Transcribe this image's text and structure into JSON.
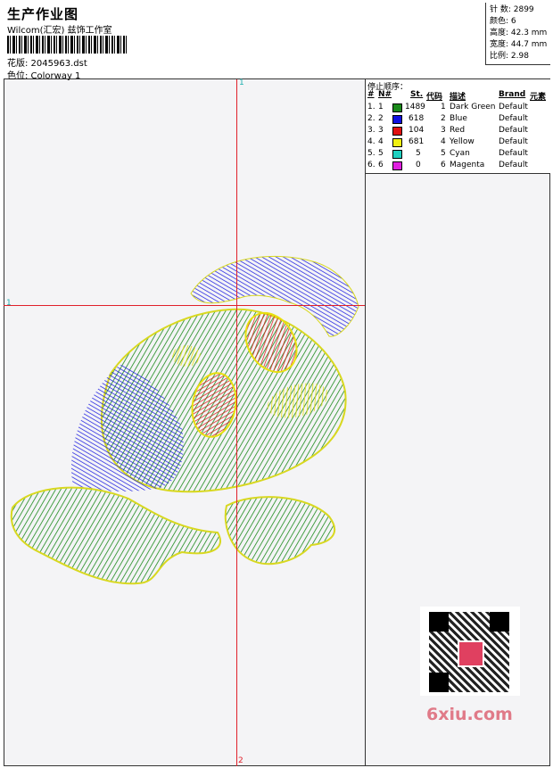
{
  "header": {
    "title": "生产作业图",
    "subtitle": "Wilcom(汇宏) 兹饰工作室",
    "design": "花版: 2045963.dst",
    "colorway": "色位: Colorway 1"
  },
  "stats": {
    "stitches": "针 数: 2899",
    "colors": "颜色: 6",
    "height": "高度: 42.3 mm",
    "width": "宽度: 44.7 mm",
    "scale": "比例: 2.98"
  },
  "guides": {
    "top": "1",
    "left": "1",
    "bottom": "2"
  },
  "stop_sequence": {
    "title": "停止顺序：",
    "headers": [
      "#",
      "N#",
      "St.",
      "代码",
      "描述",
      "Brand",
      "元素"
    ],
    "rows": [
      {
        "num": "1.",
        "n": "1",
        "color": "#1a8a1a",
        "st": "1489",
        "code": "1",
        "desc": "Dark Green",
        "brand": "Default"
      },
      {
        "num": "2.",
        "n": "2",
        "color": "#1010e0",
        "st": "618",
        "code": "2",
        "desc": "Blue",
        "brand": "Default"
      },
      {
        "num": "3.",
        "n": "3",
        "color": "#e01010",
        "st": "104",
        "code": "3",
        "desc": "Red",
        "brand": "Default"
      },
      {
        "num": "4.",
        "n": "4",
        "color": "#f0f010",
        "st": "681",
        "code": "4",
        "desc": "Yellow",
        "brand": "Default"
      },
      {
        "num": "5.",
        "n": "5",
        "color": "#20d0c0",
        "st": "5",
        "code": "5",
        "desc": "Cyan",
        "brand": "Default"
      },
      {
        "num": "6.",
        "n": "6",
        "color": "#e020e0",
        "st": "0",
        "code": "6",
        "desc": "Magenta",
        "brand": "Default"
      }
    ]
  },
  "watermark": {
    "brand": "6xiu.com"
  }
}
